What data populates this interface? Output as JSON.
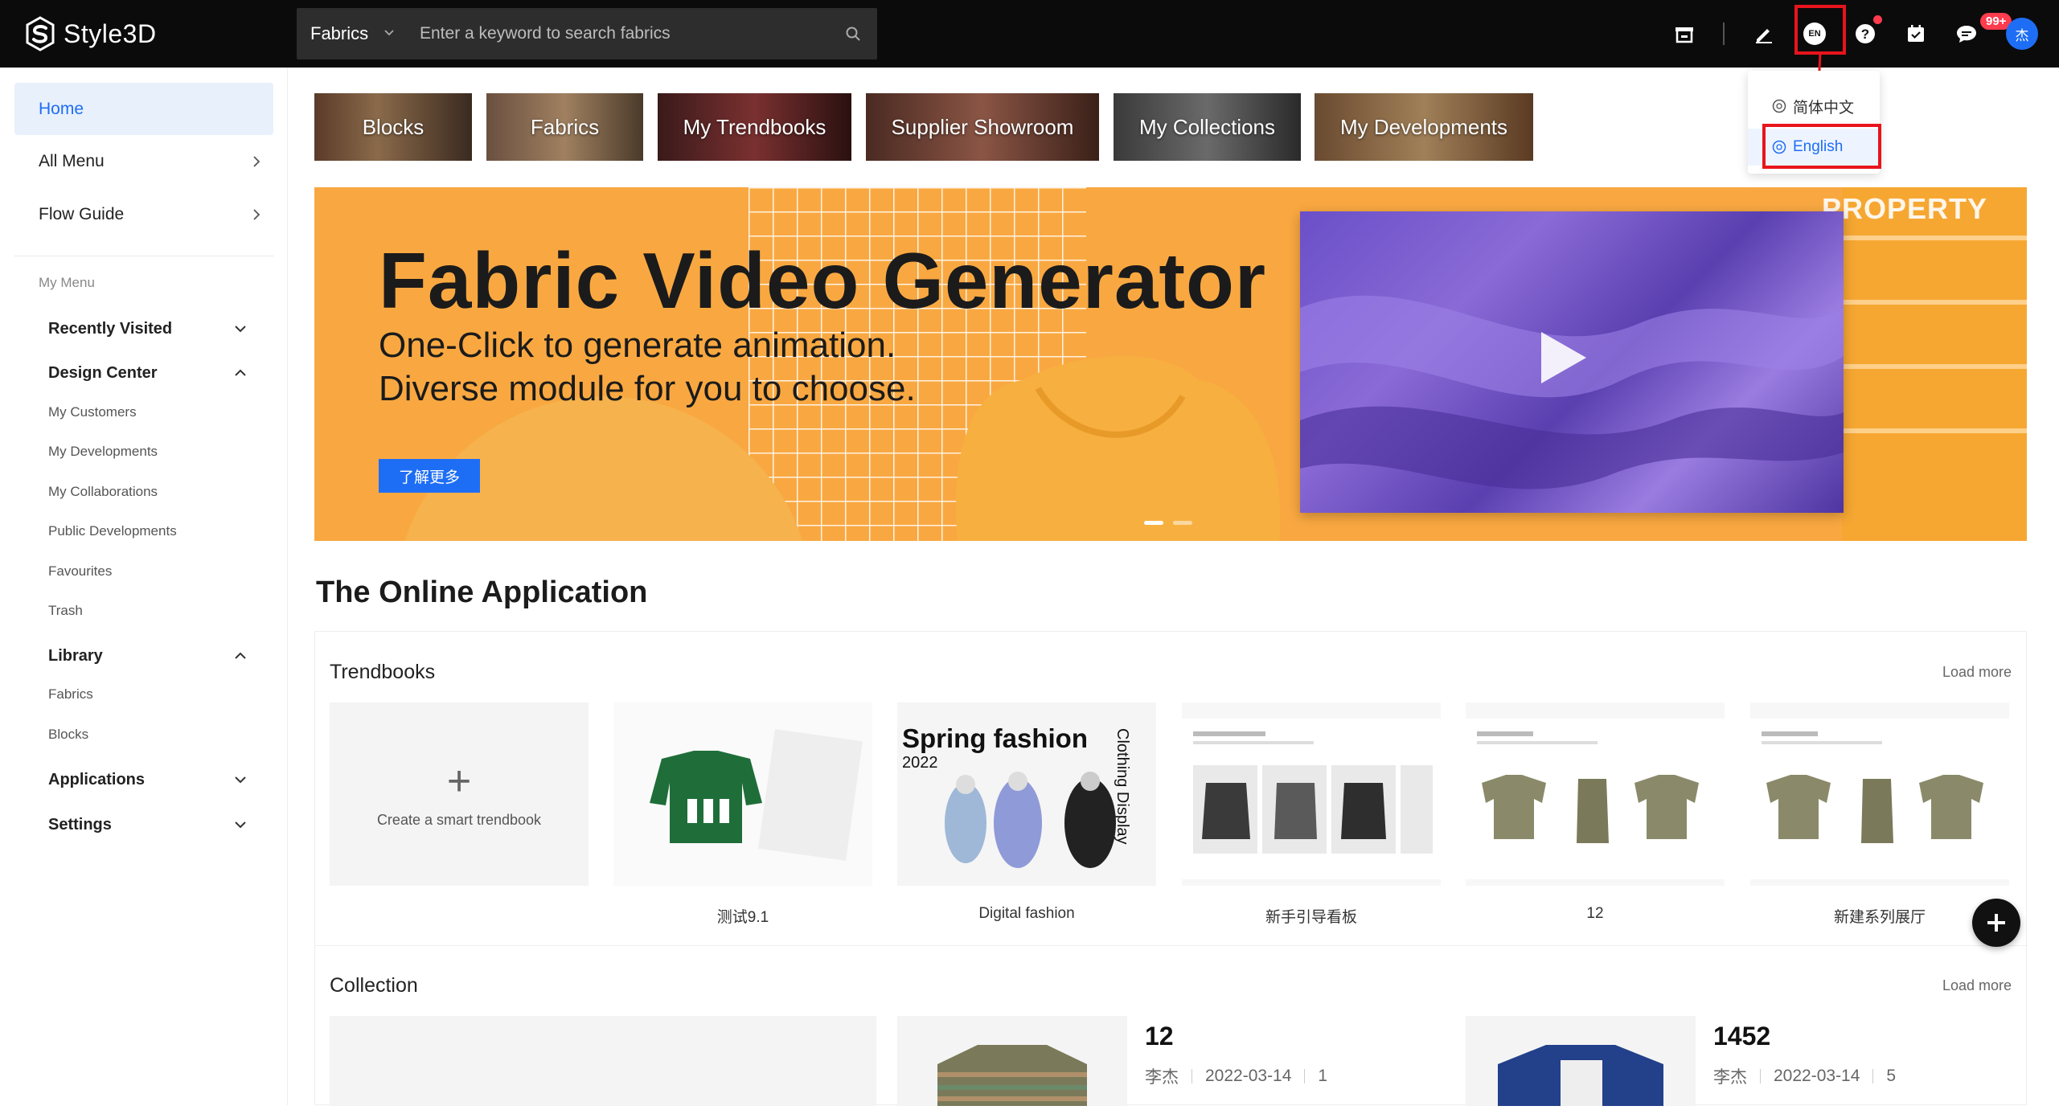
{
  "app": {
    "name": "Style3D"
  },
  "search": {
    "category": "Fabrics",
    "placeholder": "Enter a keyword to search fabrics"
  },
  "topbar": {
    "lang_code": "EN",
    "message_badge": "99+",
    "avatar_initial": "杰"
  },
  "language_menu": {
    "items": [
      {
        "label": "简体中文"
      },
      {
        "label": "English"
      }
    ],
    "selected": "English"
  },
  "sidebar": {
    "home": "Home",
    "all_menu": "All Menu",
    "flow_guide": "Flow Guide",
    "my_menu_caption": "My Menu",
    "recently_visited": "Recently Visited",
    "design_center": {
      "label": "Design Center",
      "items": [
        {
          "label": "My Customers"
        },
        {
          "label": "My Developments"
        },
        {
          "label": "My Collaborations"
        },
        {
          "label": "Public Developments"
        },
        {
          "label": "Favourites"
        },
        {
          "label": "Trash"
        }
      ]
    },
    "library": {
      "label": "Library",
      "items": [
        {
          "label": "Fabrics"
        },
        {
          "label": "Blocks"
        }
      ]
    },
    "applications": "Applications",
    "settings": "Settings"
  },
  "tiles": [
    {
      "label": "Blocks"
    },
    {
      "label": "Fabrics"
    },
    {
      "label": "My Trendbooks"
    },
    {
      "label": "Supplier Showroom"
    },
    {
      "label": "My Collections"
    },
    {
      "label": "My Developments"
    }
  ],
  "banner": {
    "title": "Fabric Video Generator",
    "subtitle_line1": "One-Click to generate animation.",
    "subtitle_line2": "Diverse module for you to choose.",
    "button": "了解更多",
    "corner_text": "PROPERTY",
    "slide_index": 1,
    "slide_count": 2
  },
  "online_application": {
    "title": "The Online Application",
    "trendbooks": {
      "title": "Trendbooks",
      "load_more": "Load more",
      "create_label": "Create a smart trendbook",
      "items": [
        {
          "label": "测试9.1"
        },
        {
          "label": "Digital fashion",
          "cover_title": "Spring fashion",
          "cover_year": "2022",
          "cover_side": "Clothing Display"
        },
        {
          "label": "新手引导看板"
        },
        {
          "label": "12"
        },
        {
          "label": "新建系列展厅"
        }
      ]
    },
    "collection": {
      "title": "Collection",
      "load_more": "Load more",
      "items": [
        {
          "name": "12",
          "owner": "李杰",
          "date": "2022-03-14",
          "count": "1"
        },
        {
          "name": "1452",
          "owner": "李杰",
          "date": "2022-03-14",
          "count": "5"
        }
      ]
    }
  },
  "colors": {
    "accent": "#1e6ef5",
    "highlight": "#e8141c",
    "topbar": "#0b0b0b",
    "banner": "#f9a841"
  }
}
